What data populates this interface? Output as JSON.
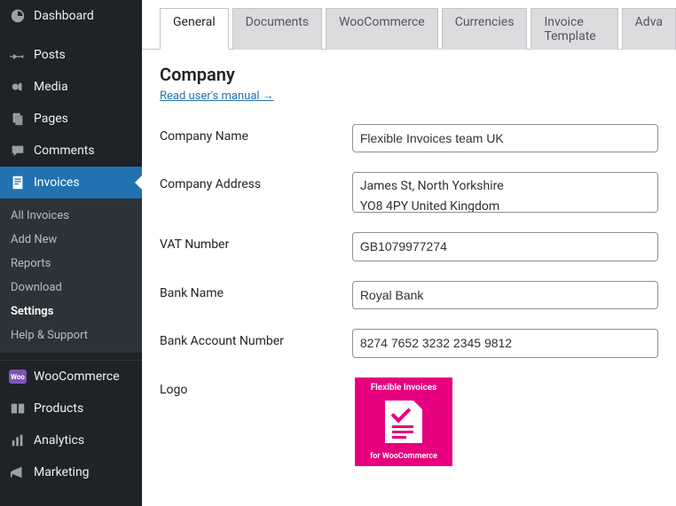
{
  "sidebar": {
    "items": [
      {
        "label": "Dashboard"
      },
      {
        "label": "Posts"
      },
      {
        "label": "Media"
      },
      {
        "label": "Pages"
      },
      {
        "label": "Comments"
      },
      {
        "label": "Invoices"
      }
    ],
    "submenu": [
      {
        "label": "All Invoices"
      },
      {
        "label": "Add New"
      },
      {
        "label": "Reports"
      },
      {
        "label": "Download"
      },
      {
        "label": "Settings"
      },
      {
        "label": "Help & Support"
      }
    ],
    "items2": [
      {
        "label": "WooCommerce"
      },
      {
        "label": "Products"
      },
      {
        "label": "Analytics"
      },
      {
        "label": "Marketing"
      }
    ]
  },
  "tabs": [
    {
      "label": "General"
    },
    {
      "label": "Documents"
    },
    {
      "label": "WooCommerce"
    },
    {
      "label": "Currencies"
    },
    {
      "label": "Invoice Template"
    },
    {
      "label": "Adva"
    }
  ],
  "section": {
    "title": "Company",
    "manual_link": "Read user's manual →"
  },
  "form": {
    "company_name": {
      "label": "Company Name",
      "value": "Flexible Invoices team UK"
    },
    "company_address": {
      "label": "Company Address",
      "value": "James St, North Yorkshire\nYO8 4PY United Kingdom"
    },
    "vat": {
      "label": "VAT Number",
      "value": "GB1079977274"
    },
    "bank_name": {
      "label": "Bank Name",
      "value": "Royal Bank"
    },
    "bank_acct": {
      "label": "Bank Account Number",
      "value": "8274 7652 3232 2345 9812"
    },
    "logo": {
      "label": "Logo"
    }
  },
  "logo_text": {
    "top": "Flexible Invoices",
    "bottom": "for WooCommerce"
  }
}
